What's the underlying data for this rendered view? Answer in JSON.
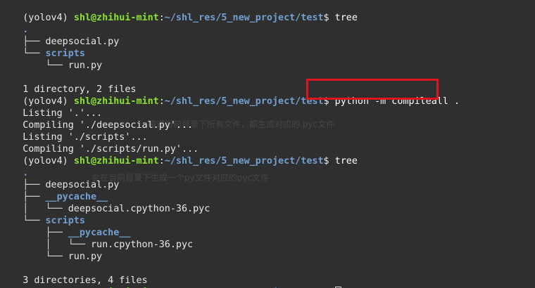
{
  "prompt": {
    "env": "(yolov4) ",
    "user": "shl@zhihui-mint",
    "colon": ":",
    "path": "~/shl_res/5_new_project/test",
    "dollar": "$ "
  },
  "commands": {
    "tree": "tree",
    "compile": "python -m compileall ."
  },
  "tree1": {
    "root": ".",
    "b1": "├── ",
    "file1": "deepsocial.py",
    "b2": "└── ",
    "dir1": "scripts",
    "b3": "    └── ",
    "file2": "run.py",
    "summary": "1 directory, 2 files"
  },
  "compile_output": {
    "l1": "Listing '.'...",
    "l2": "Compiling './deepsocial.py'...",
    "l3": "Listing './scripts'...",
    "l4": "Compiling './scripts/run.py'..."
  },
  "tree2": {
    "root": ".",
    "b1": "├── ",
    "file1": "deepsocial.py",
    "b2": "├── ",
    "dir1": "__pycache__",
    "b3": "│   └── ",
    "file2": "deepsocial.cpython-36.pyc",
    "b4": "└── ",
    "dir2": "scripts",
    "b5": "    ├── ",
    "dir3": "__pycache__",
    "b6": "    │   └── ",
    "file3": "run.cpython-36.pyc",
    "b7": "    └── ",
    "file4": "run.py",
    "summary": "3 directories, 4 files"
  },
  "watermarks": {
    "w1": "编译当前目录下所有文件，都生成对应的.pyc文件",
    "w2": "会在当前目录下生成一个py文件对应的pyc文件"
  },
  "colors": {
    "background": "#2f2f2f",
    "user": "#8ae234",
    "path": "#729fcf",
    "highlight": "#e0141f"
  }
}
